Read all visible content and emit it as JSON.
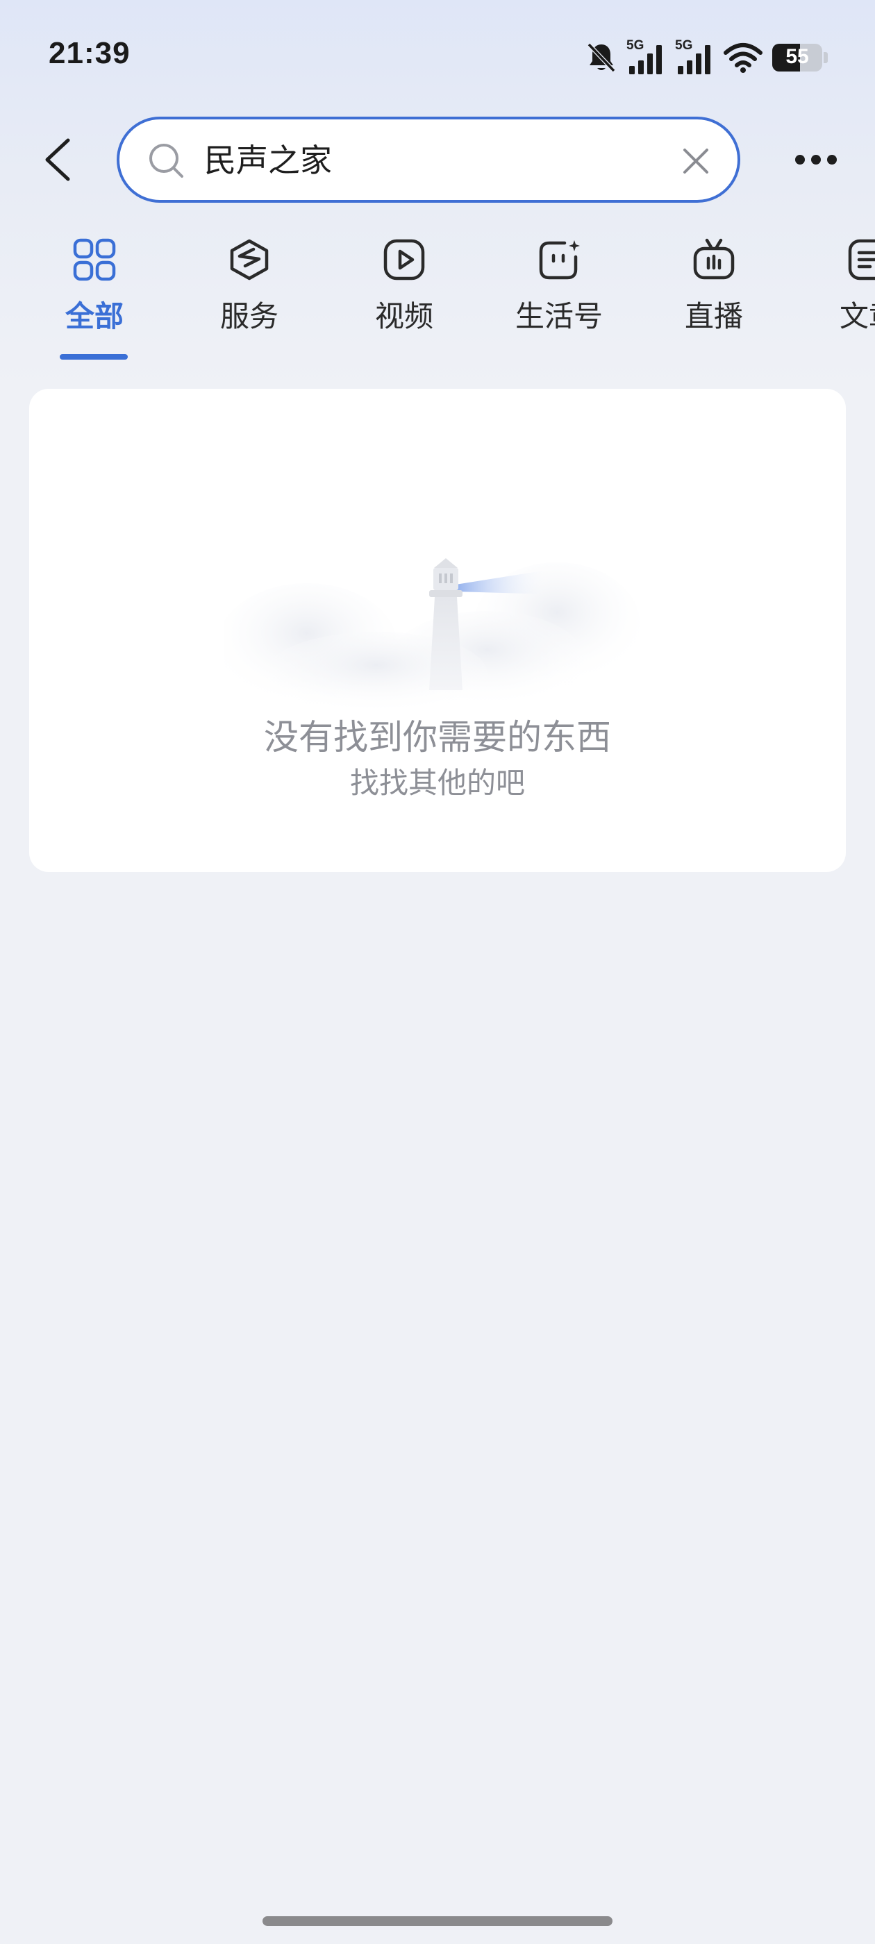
{
  "status_bar": {
    "time": "21:39",
    "signal_1_label": "5G",
    "signal_2_label": "5G",
    "battery_level": "55",
    "icons": [
      "bell-muted-icon",
      "signal-5g-icon",
      "signal-5g-icon",
      "wifi-icon",
      "battery-icon"
    ]
  },
  "search": {
    "query": "民声之家"
  },
  "tabs": [
    {
      "label": "全部",
      "icon": "grid-icon",
      "active": true
    },
    {
      "label": "服务",
      "icon": "service-cube-icon",
      "active": false
    },
    {
      "label": "视频",
      "icon": "play-icon",
      "active": false
    },
    {
      "label": "生活号",
      "icon": "life-account-icon",
      "active": false
    },
    {
      "label": "直播",
      "icon": "tv-live-icon",
      "active": false
    },
    {
      "label": "文章",
      "icon": "article-icon",
      "active": false
    }
  ],
  "empty_state": {
    "title": "没有找到你需要的东西",
    "subtitle": "找找其他的吧",
    "illustration": "lighthouse-clouds"
  },
  "colors": {
    "accent": "#3a6fd6",
    "background": "#eff1f6",
    "muted_text": "#8d8f96"
  }
}
